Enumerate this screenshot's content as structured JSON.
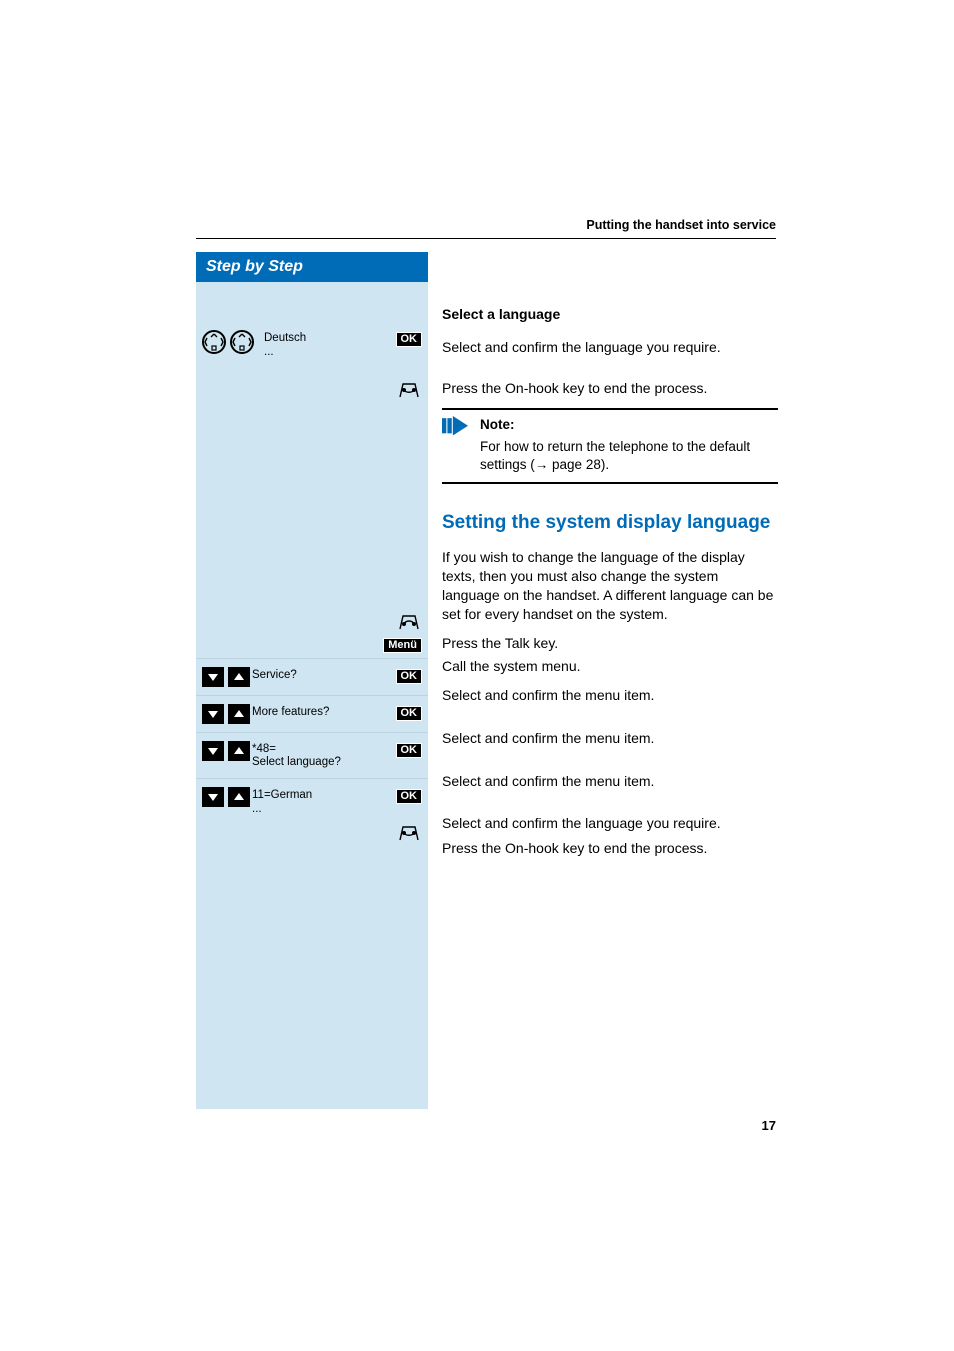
{
  "running_header": "Putting the handset into service",
  "sidebar_title": "Step by Step",
  "subheading_a": "Select a language",
  "steps": {
    "deutsch_label": "Deutsch\n...",
    "ok_label": "OK",
    "menu_label": "Menü",
    "service_label": "Service?",
    "more_features_label": "More features?",
    "code48_line1": "*48=",
    "code48_line2": "Select language?",
    "german_label": "11=German\n..."
  },
  "right_texts": {
    "select_confirm_lang": "Select and confirm the language you require.",
    "press_onhook": "Press the On-hook key to end the process.",
    "note_title": "Note:",
    "note_body_a": "For how to return the telephone to the default settings (",
    "note_body_arrow": "→",
    "note_body_b": " page 28).",
    "section_heading": "Setting the system display language",
    "section_intro": "If you wish to change the language of the display texts, then you must also change the system language on the handset. A different language can be set for every handset on the system.",
    "press_talk": "Press the Talk key.",
    "call_system_menu": "Call the system menu.",
    "select_confirm_menu": "Select and confirm the menu item."
  },
  "page_number": "17"
}
